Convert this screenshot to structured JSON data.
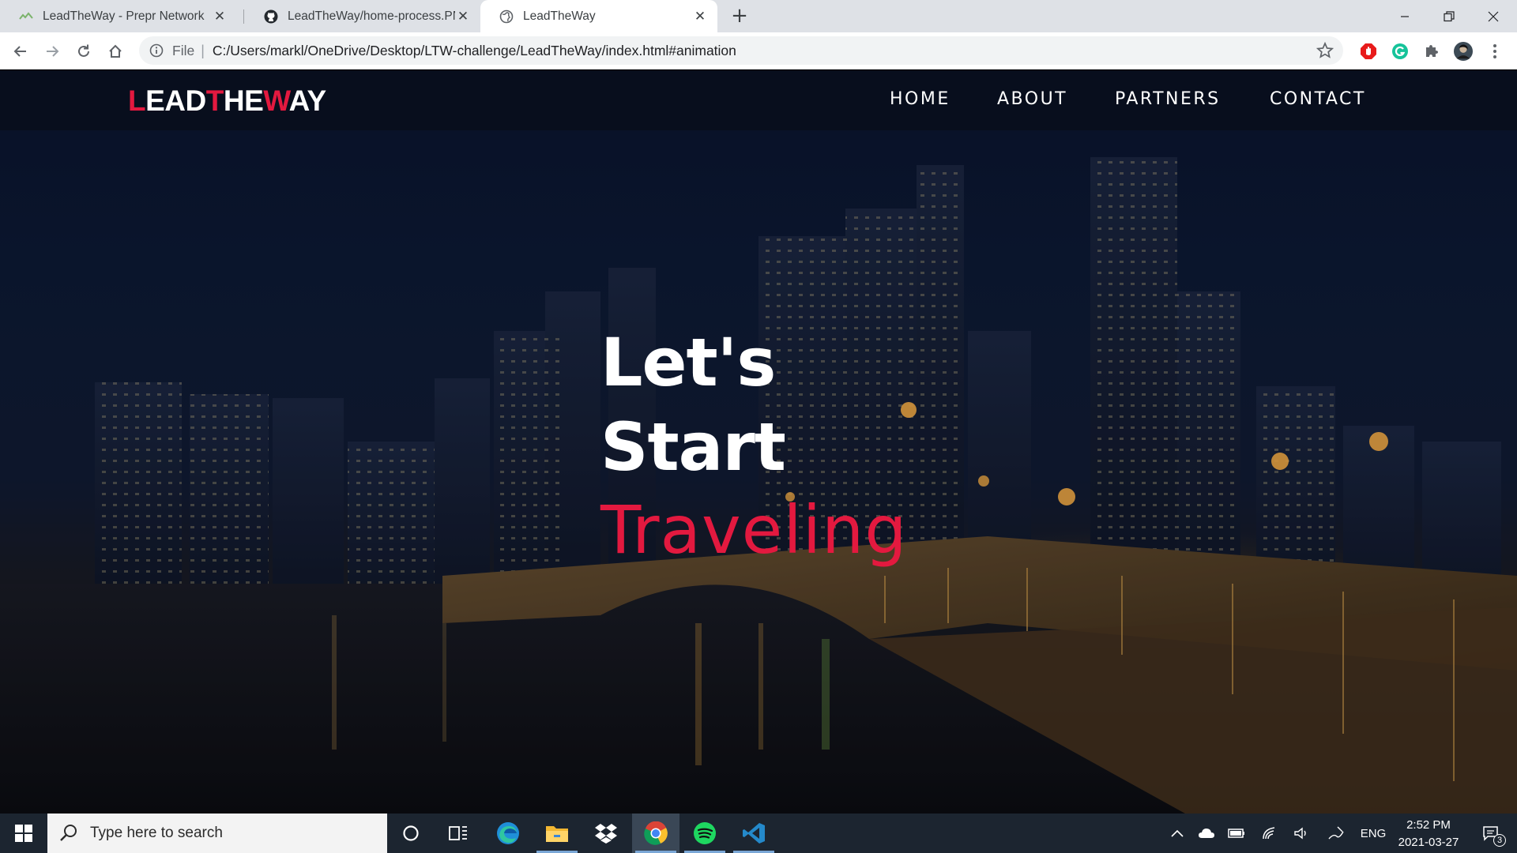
{
  "browser": {
    "tabs": [
      {
        "title": "LeadTheWay - Prepr Network",
        "icon": "prepr-favicon-icon"
      },
      {
        "title": "LeadTheWay/home-process.PNG",
        "icon": "github-icon"
      },
      {
        "title": "LeadTheWay",
        "icon": "globe-icon",
        "active": true
      }
    ],
    "close_glyph": "✕",
    "new_tab_glyph": "+",
    "omnibox": {
      "scheme_label": "File",
      "separator": "|",
      "url": "C:/Users/markl/OneDrive/Desktop/LTW-challenge/LeadTheWay/index.html#animation"
    },
    "extensions": [
      "adblock-icon",
      "grammarly-icon",
      "puzzle-extensions-icon",
      "profile-avatar-icon",
      "kebab-menu-icon"
    ]
  },
  "site": {
    "logo": {
      "p1": "L",
      "p2": "EAD",
      "p3": "T",
      "p4": "HE",
      "p5": "W",
      "p6": "AY"
    },
    "nav": [
      "HOME",
      "ABOUT",
      "PARTNERS",
      "CONTACT"
    ],
    "hero": {
      "line1": "Let's",
      "line2": "Start",
      "line3": "Traveling"
    },
    "accent_color": "#e3193f"
  },
  "taskbar": {
    "search_placeholder": "Type here to search",
    "apps": [
      "cortana-icon",
      "task-view-icon",
      "edge-icon",
      "file-explorer-icon",
      "dropbox-icon",
      "chrome-icon",
      "spotify-icon",
      "vscode-icon"
    ],
    "language": "ENG",
    "time": "2:52 PM",
    "date": "2021-03-27",
    "notification_count": "3"
  }
}
